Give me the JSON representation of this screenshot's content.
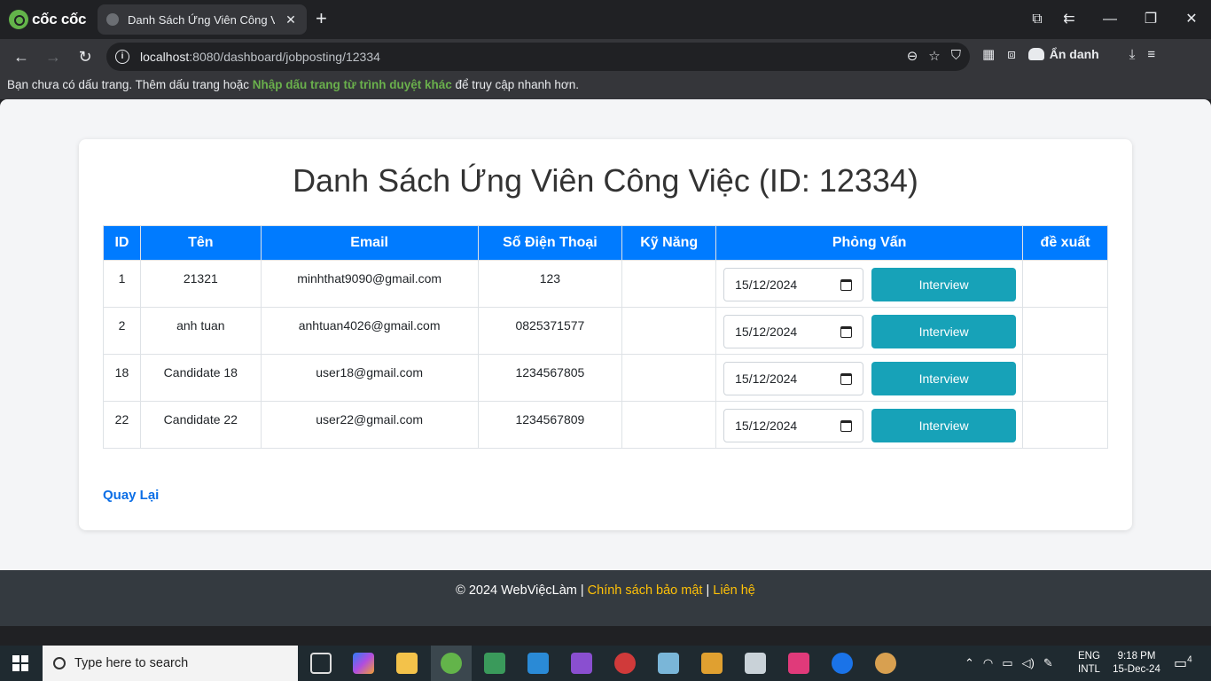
{
  "browser": {
    "brand": "cốc cốc",
    "tab_title": "Danh Sách Ứng Viên Công Việc",
    "url_host": "localhost",
    "url_rest": ":8080/dashboard/jobposting/12334",
    "incognito_label": "Ẩn danh",
    "bookmark_msg_start": "Bạn chưa có dấu trang. Thêm dấu trang hoặc ",
    "bookmark_link": "Nhập dấu trang từ trình duyệt khác",
    "bookmark_msg_end": " để truy cập nhanh hơn."
  },
  "page": {
    "title": "Danh Sách Ứng Viên Công Việc (ID: 12334)",
    "columns": [
      "ID",
      "Tên",
      "Email",
      "Số Điện Thoại",
      "Kỹ Năng",
      "Phỏng Vấn",
      "đề xuất"
    ],
    "rows": [
      {
        "id": "1",
        "name": "21321",
        "email": "minhthat9090@gmail.com",
        "phone": "123",
        "skills": "",
        "date": "15/12/2024",
        "button": "Interview",
        "suggest": ""
      },
      {
        "id": "2",
        "name": "anh tuan",
        "email": "anhtuan4026@gmail.com",
        "phone": "0825371577",
        "skills": "",
        "date": "15/12/2024",
        "button": "Interview",
        "suggest": ""
      },
      {
        "id": "18",
        "name": "Candidate 18",
        "email": "user18@gmail.com",
        "phone": "1234567805",
        "skills": "",
        "date": "15/12/2024",
        "button": "Interview",
        "suggest": ""
      },
      {
        "id": "22",
        "name": "Candidate 22",
        "email": "user22@gmail.com",
        "phone": "1234567809",
        "skills": "",
        "date": "15/12/2024",
        "button": "Interview",
        "suggest": ""
      }
    ],
    "back_link": "Quay Lại"
  },
  "footer": {
    "copyright": "© 2024 WebViệcLàm | ",
    "privacy": "Chính sách bảo mật",
    "sep": " | ",
    "contact": "Liên hệ"
  },
  "taskbar": {
    "search_placeholder": "Type here to search",
    "lang_line1": "ENG",
    "lang_line2": "INTL",
    "time": "9:18 PM",
    "date": "15-Dec-24",
    "notification_count": "4"
  },
  "colors": {
    "header_blue": "#007bff",
    "interview_button": "#17a2b8",
    "footer_bg": "#343a40",
    "footer_link": "#ffc107"
  }
}
